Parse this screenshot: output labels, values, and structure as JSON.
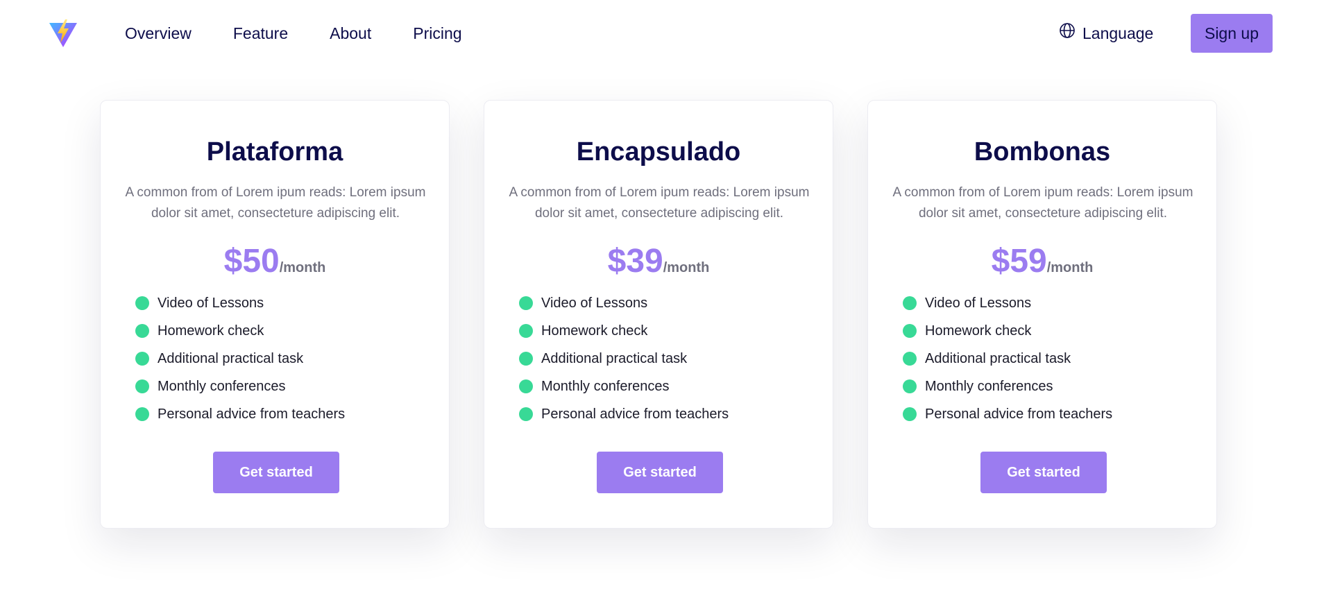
{
  "nav": {
    "items": [
      "Overview",
      "Feature",
      "About",
      "Pricing"
    ],
    "language_label": "Language",
    "language_icon": "globe-icon",
    "signup_label": "Sign up",
    "logo_icon": "bolt-triangle-logo"
  },
  "colors": {
    "accent": "#9b7cf0",
    "check": "#38d996",
    "heading": "#0d0d4a",
    "muted": "#6f6f7d"
  },
  "plans": [
    {
      "name": "Plataforma",
      "description": "A common from of Lorem ipum reads: Lorem ipsum dolor sit amet, consecteture adipiscing elit.",
      "price": "$50",
      "period": "/month",
      "features": [
        "Video of Lessons",
        "Homework check",
        "Additional practical task",
        "Monthly conferences",
        "Personal advice from teachers"
      ],
      "cta": "Get started"
    },
    {
      "name": "Encapsulado",
      "description": "A common from of Lorem ipum reads: Lorem ipsum dolor sit amet, consecteture adipiscing elit.",
      "price": "$39",
      "period": "/month",
      "features": [
        "Video of Lessons",
        "Homework check",
        "Additional practical task",
        "Monthly conferences",
        "Personal advice from teachers"
      ],
      "cta": "Get started"
    },
    {
      "name": "Bombonas",
      "description": "A common from of Lorem ipum reads: Lorem ipsum dolor sit amet, consecteture adipiscing elit.",
      "price": "$59",
      "period": "/month",
      "features": [
        "Video of Lessons",
        "Homework check",
        "Additional practical task",
        "Monthly conferences",
        "Personal advice from teachers"
      ],
      "cta": "Get started"
    }
  ]
}
